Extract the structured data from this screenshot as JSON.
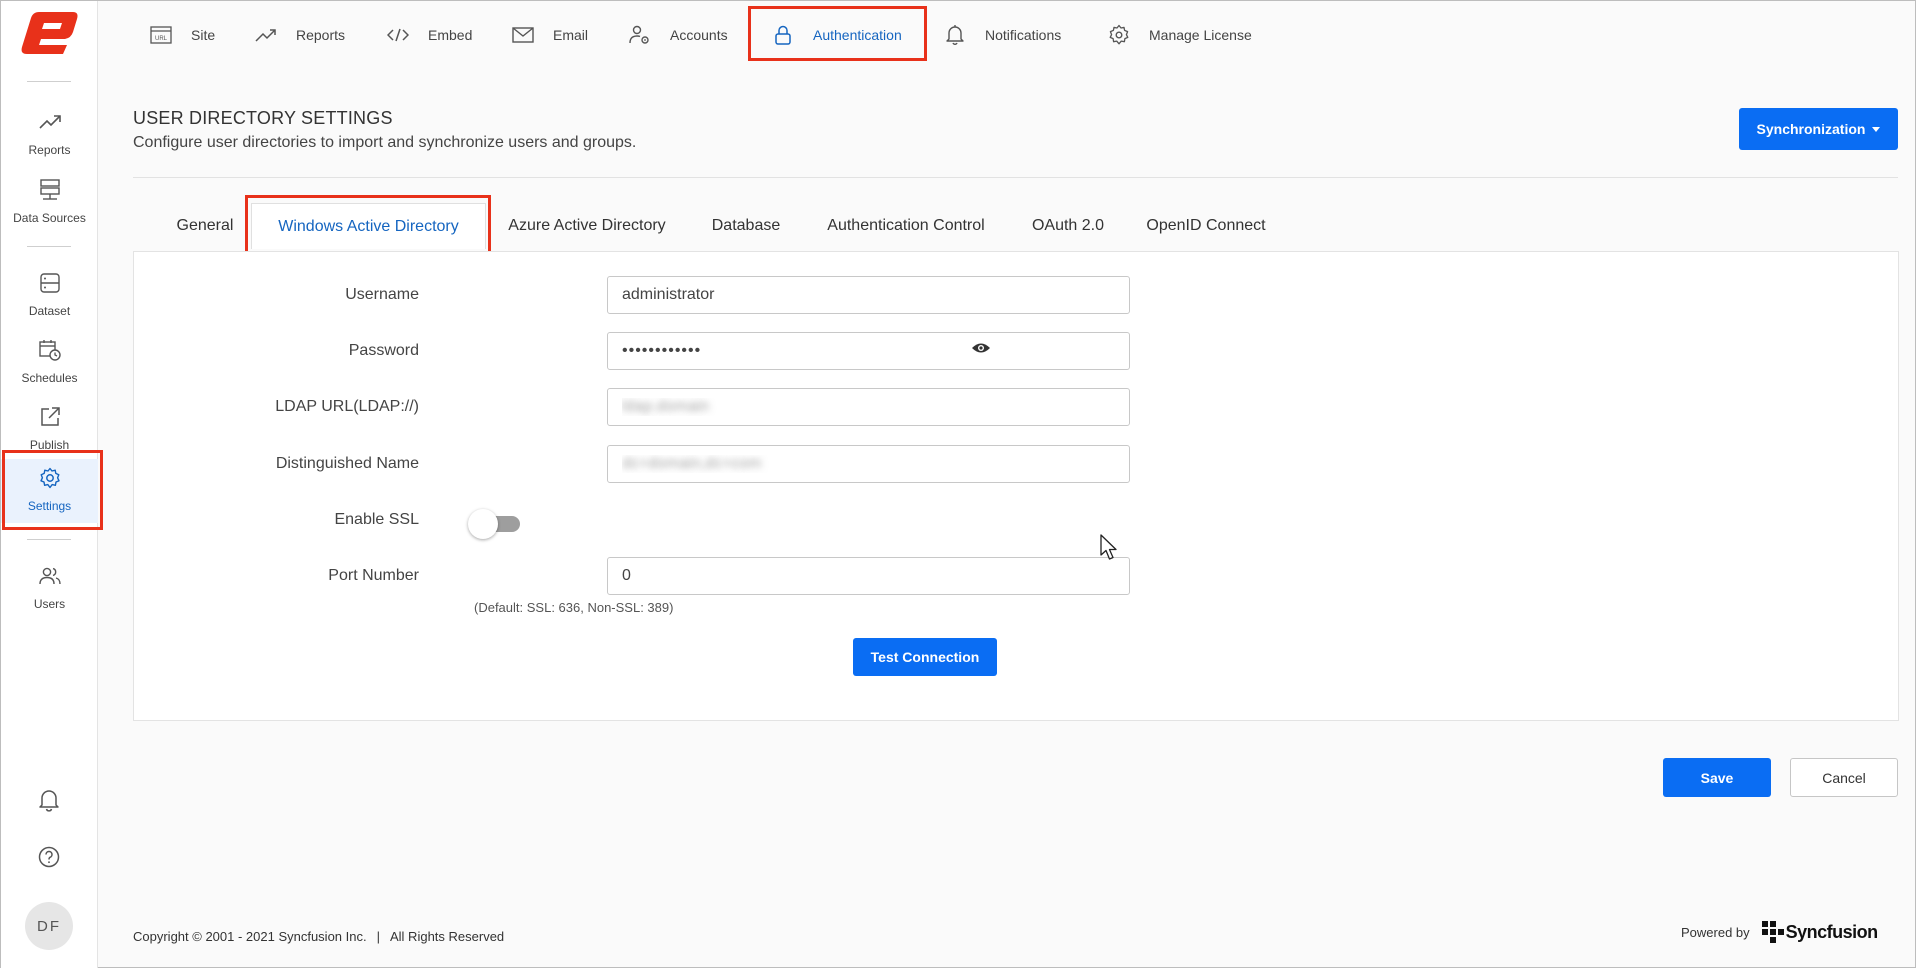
{
  "sidebar": {
    "items": [
      {
        "label": "Reports"
      },
      {
        "label": "Data Sources"
      },
      {
        "label": "Dataset"
      },
      {
        "label": "Schedules"
      },
      {
        "label": "Publish"
      },
      {
        "label": "Settings"
      },
      {
        "label": "Users"
      }
    ],
    "avatar_initials": "DF"
  },
  "topnav": {
    "items": [
      {
        "label": "Site",
        "icon": "url-icon"
      },
      {
        "label": "Reports",
        "icon": "trend-icon"
      },
      {
        "label": "Embed",
        "icon": "code-icon"
      },
      {
        "label": "Email",
        "icon": "mail-icon"
      },
      {
        "label": "Accounts",
        "icon": "user-gear-icon"
      },
      {
        "label": "Authentication",
        "icon": "lock-icon"
      },
      {
        "label": "Notifications",
        "icon": "bell-icon"
      },
      {
        "label": "Manage License",
        "icon": "gear-badge-icon"
      }
    ],
    "active": "Authentication"
  },
  "header": {
    "title": "USER DIRECTORY SETTINGS",
    "subtitle": "Configure user directories to import and synchronize users and groups.",
    "sync_label": "Synchronization"
  },
  "tabs": [
    {
      "label": "General"
    },
    {
      "label": "Windows Active Directory"
    },
    {
      "label": "Azure Active Directory"
    },
    {
      "label": "Database"
    },
    {
      "label": "Authentication Control"
    },
    {
      "label": "OAuth 2.0"
    },
    {
      "label": "OpenID Connect"
    }
  ],
  "form": {
    "username": {
      "label": "Username",
      "value": "administrator"
    },
    "password": {
      "label": "Password",
      "value": "••••••••••••"
    },
    "ldap": {
      "label": "LDAP URL(LDAP://)",
      "value": "ldap.domain"
    },
    "dn": {
      "label": "Distinguished Name",
      "value": "dc=domain,dc=com"
    },
    "ssl": {
      "label": "Enable SSL",
      "enabled": false
    },
    "port": {
      "label": "Port Number",
      "value": "0",
      "hint": "(Default: SSL: 636, Non-SSL: 389)"
    },
    "test_label": "Test Connection"
  },
  "actions": {
    "save_label": "Save",
    "cancel_label": "Cancel"
  },
  "footer": {
    "copyright": "Copyright © 2001 - 2021 Syncfusion Inc.",
    "separator": "|",
    "rights": "All Rights Reserved",
    "powered_by": "Powered by",
    "brand": "Syncfusion"
  },
  "colors": {
    "accent": "#0a6df3",
    "highlight": "#e8311a",
    "brand_red": "#e8311a"
  }
}
